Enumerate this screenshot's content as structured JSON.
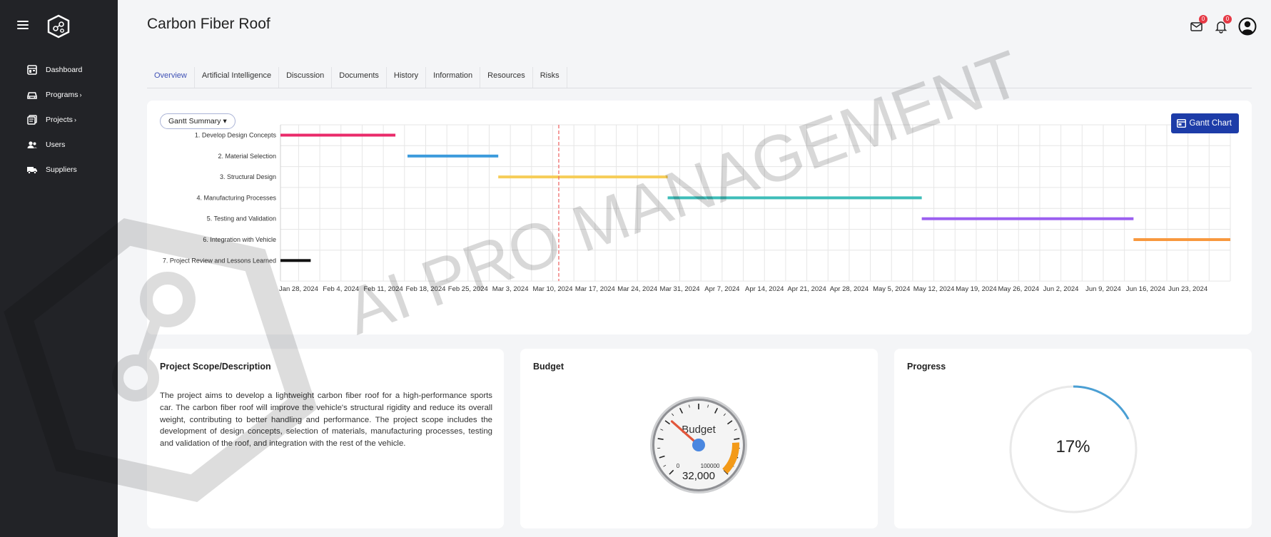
{
  "app": {
    "page_title": "Carbon Fiber Roof",
    "watermark_text": "AI PRO MANAGEMENT"
  },
  "sidebar": {
    "items": [
      {
        "label": "Dashboard",
        "icon": "dashboard-icon",
        "chevron": ""
      },
      {
        "label": "Programs",
        "icon": "car-icon",
        "chevron": "›"
      },
      {
        "label": "Projects",
        "icon": "projects-icon",
        "chevron": "›"
      },
      {
        "label": "Users",
        "icon": "users-icon",
        "chevron": ""
      },
      {
        "label": "Suppliers",
        "icon": "truck-icon",
        "chevron": ""
      }
    ]
  },
  "header": {
    "mail_count": "0",
    "notification_count": "0"
  },
  "tabs": [
    "Overview",
    "Artificial Intelligence",
    "Discussion",
    "Documents",
    "History",
    "Information",
    "Resources",
    "Risks"
  ],
  "active_tab": "Overview",
  "gantt": {
    "dropdown_label": "Gantt Summary",
    "button_label": "Gantt Chart"
  },
  "chart_data": {
    "type": "gantt",
    "x_ticks": [
      "Jan 28, 2024",
      "Feb 4, 2024",
      "Feb 11, 2024",
      "Feb 18, 2024",
      "Feb 25, 2024",
      "Mar 3, 2024",
      "Mar 10, 2024",
      "Mar 17, 2024",
      "Mar 24, 2024",
      "Mar 31, 2024",
      "Apr 7, 2024",
      "Apr 14, 2024",
      "Apr 21, 2024",
      "Apr 28, 2024",
      "May 5, 2024",
      "May 12, 2024",
      "May 19, 2024",
      "May 26, 2024",
      "Jun 2, 2024",
      "Jun 9, 2024",
      "Jun 16, 2024",
      "Jun 23, 2024"
    ],
    "xlim": [
      "2024-01-25",
      "2024-06-30"
    ],
    "today": "2024-03-11",
    "tasks": [
      {
        "name": "1. Develop Design Concepts",
        "start": "2024-01-25",
        "end": "2024-02-13",
        "color": "#ea2a6a"
      },
      {
        "name": "2. Material Selection",
        "start": "2024-02-15",
        "end": "2024-03-01",
        "color": "#3b9bdc"
      },
      {
        "name": "3. Structural Design",
        "start": "2024-03-01",
        "end": "2024-03-29",
        "color": "#f6cd58"
      },
      {
        "name": "4. Manufacturing Processes",
        "start": "2024-03-29",
        "end": "2024-05-10",
        "color": "#3ebdb9"
      },
      {
        "name": "5. Testing and Validation",
        "start": "2024-05-10",
        "end": "2024-06-14",
        "color": "#9b5ff0"
      },
      {
        "name": "6. Integration with Vehicle",
        "start": "2024-06-14",
        "end": "2024-06-30",
        "color": "#f8983e"
      },
      {
        "name": "7. Project Review and Lessons Learned",
        "start": "2024-01-25",
        "end": "2024-01-30",
        "color": "#111111"
      }
    ],
    "grid": true
  },
  "scope": {
    "title": "Project Scope/Description",
    "text": "The project aims to develop a lightweight carbon fiber roof for a high-performance sports car. The carbon fiber roof will improve the vehicle's structural rigidity and reduce its overall weight, contributing to better handling and performance. The project scope includes the development of design concepts, selection of materials, manufacturing processes, testing and validation of the roof, and integration with the rest of the vehicle."
  },
  "budget": {
    "title": "Budget",
    "gauge_label": "Budget",
    "value": 32000,
    "value_text": "32,000",
    "min_label": "0",
    "max_label": "100000",
    "min": 0,
    "max": 100000
  },
  "progress": {
    "title": "Progress",
    "percent": 17,
    "percent_text": "17%",
    "color": "#4a9fd4"
  }
}
